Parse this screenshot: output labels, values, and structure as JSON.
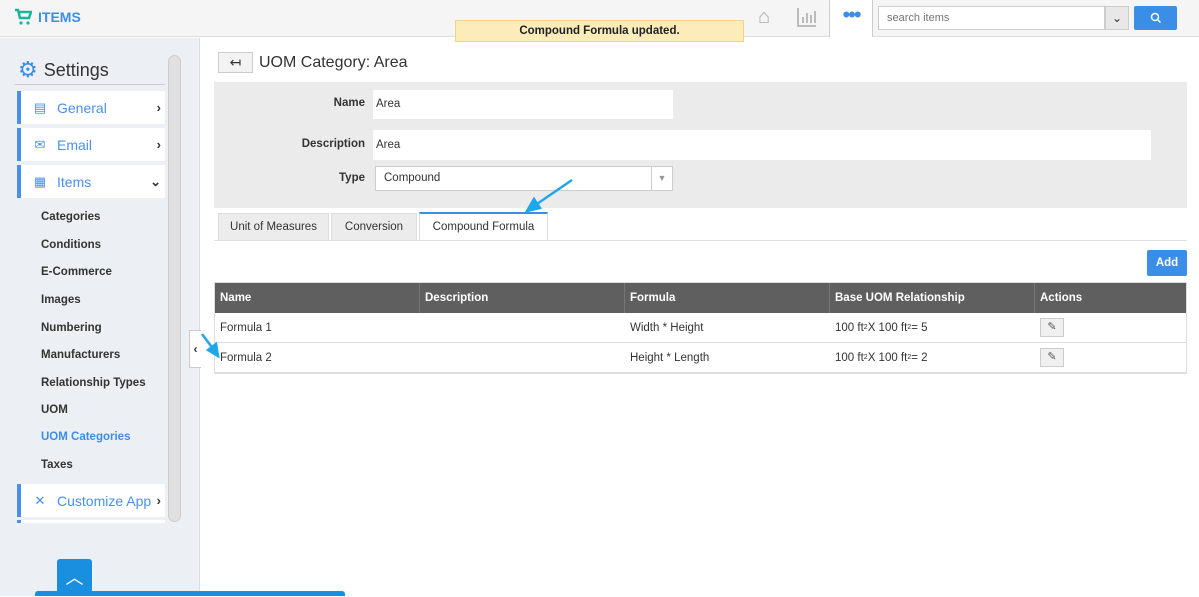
{
  "app": {
    "title": "ITEMS",
    "icon": "shopping-cart-icon",
    "accent": "#3b8ee8"
  },
  "toast": "Compound Formula updated.",
  "topbar": {
    "icons": [
      "home-icon",
      "bar-chart-icon",
      "more-dots-icon"
    ],
    "search_placeholder": "search items"
  },
  "sidebar": {
    "title": "Settings",
    "sections": [
      {
        "label": "General",
        "icon": "monitor-icon"
      },
      {
        "label": "Email",
        "icon": "envelope-icon"
      },
      {
        "label": "Items",
        "icon": "list-icon"
      },
      {
        "label": "Customize App",
        "icon": "tools-icon"
      }
    ],
    "subitems": [
      "Categories",
      "Conditions",
      "E-Commerce",
      "Images",
      "Numbering",
      "Manufacturers",
      "Relationship Types",
      "UOM",
      "UOM Categories",
      "Taxes"
    ],
    "active_subitem": "UOM Categories"
  },
  "page": {
    "title": "UOM Category: Area",
    "form": {
      "name_label": "Name",
      "name_value": "Area",
      "description_label": "Description",
      "description_value": "Area",
      "type_label": "Type",
      "type_value": "Compound"
    },
    "tabs": [
      "Unit of Measures",
      "Conversion",
      "Compound Formula"
    ],
    "active_tab": "Compound Formula",
    "add_label": "Add",
    "table": {
      "headers": [
        "Name",
        "Description",
        "Formula",
        "Base UOM Relationship",
        "Actions"
      ],
      "rows": [
        {
          "name": "Formula 1",
          "description": "",
          "formula": "Width *  Height",
          "rel_a": "100 ft",
          "rel_b": " X 100 ft",
          "rel_c": " = 5"
        },
        {
          "name": "Formula 2",
          "description": "",
          "formula": "Height *  Length",
          "rel_a": "100 ft",
          "rel_b": " X 100 ft",
          "rel_c": " = 2"
        }
      ],
      "sup": "2"
    }
  }
}
